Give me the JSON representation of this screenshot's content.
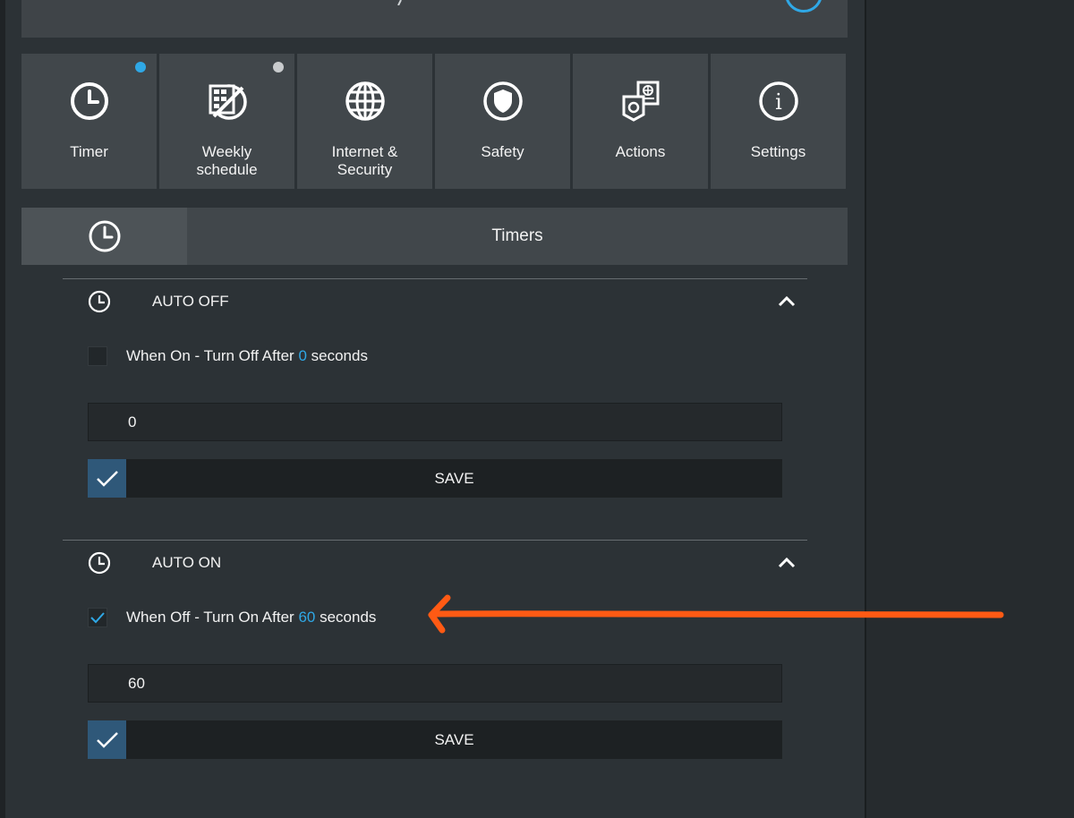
{
  "colors": {
    "accent": "#2fa8e6",
    "arrow": "#ff5a14",
    "panel": "#2c3236",
    "tile": "#41474b",
    "save_check": "#2f5879"
  },
  "tiles": [
    {
      "label": "Timer",
      "icon": "clock-icon",
      "badge": "blue"
    },
    {
      "label": "Weekly\nschedule",
      "icon": "calendar-disabled-icon",
      "badge": "gray"
    },
    {
      "label": "Internet &\nSecurity",
      "icon": "globe-icon"
    },
    {
      "label": "Safety",
      "icon": "shield-icon"
    },
    {
      "label": "Actions",
      "icon": "actions-icon"
    },
    {
      "label": "Settings",
      "icon": "info-icon"
    }
  ],
  "tabbar": {
    "title": "Timers",
    "icon": "clock-icon"
  },
  "auto_off": {
    "title": "AUTO OFF",
    "checkbox_text_before": "When On - Turn Off After ",
    "checkbox_value": "0",
    "checkbox_text_after": " seconds",
    "checked": false,
    "input_value": "0",
    "save_label": "SAVE"
  },
  "auto_on": {
    "title": "AUTO ON",
    "checkbox_text_before": "When Off - Turn On After ",
    "checkbox_value": "60",
    "checkbox_text_after": " seconds",
    "checked": true,
    "input_value": "60",
    "save_label": "SAVE"
  }
}
